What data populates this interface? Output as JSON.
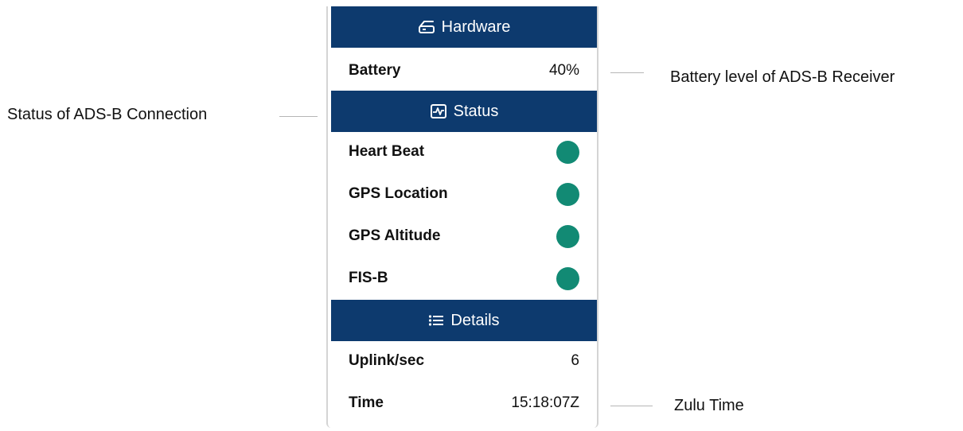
{
  "hardware": {
    "title": "Hardware",
    "icon": "router-icon",
    "battery_label": "Battery",
    "battery_value": "40%"
  },
  "status": {
    "title": "Status",
    "icon": "pulse-chart-icon",
    "indicator_color": "#128a74",
    "items": [
      {
        "label": "Heart Beat"
      },
      {
        "label": "GPS Location"
      },
      {
        "label": "GPS Altitude"
      },
      {
        "label": "FIS-B"
      }
    ]
  },
  "details": {
    "title": "Details",
    "icon": "list-icon",
    "uplink_label": "Uplink/sec",
    "uplink_value": "6",
    "time_label": "Time",
    "time_value": "15:18:07Z"
  },
  "annotations": {
    "battery": "Battery level of ADS-B Receiver",
    "status": "Status of ADS-B Connection",
    "time": "Zulu Time"
  },
  "colors": {
    "header_bg": "#0d3a6e",
    "header_text": "#ffffff"
  }
}
